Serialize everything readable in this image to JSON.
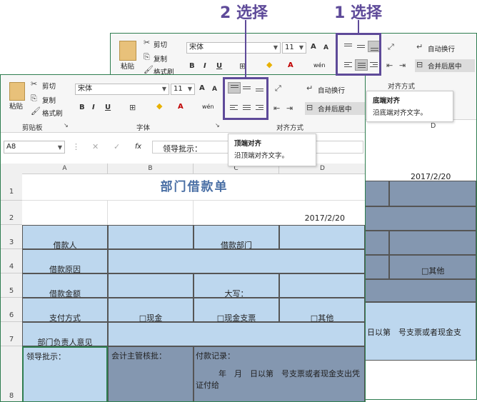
{
  "annotations": {
    "step1": "1 选择",
    "step2": "2 选择"
  },
  "clipboard": {
    "paste": "粘贴",
    "cut": "剪切",
    "copy": "复制",
    "format_painter": "格式刷",
    "group_label": "剪贴板"
  },
  "font": {
    "name": "宋体",
    "size": "11",
    "grow": "A",
    "shrink": "A",
    "bold": "B",
    "italic": "I",
    "underline": "U",
    "group_label": "字体",
    "font_color": "A",
    "phonetic": "wén"
  },
  "alignment": {
    "group_label": "对齐方式",
    "wrap_text": "自动换行",
    "merge_center": "合并后居中"
  },
  "tooltip_back": {
    "title": "底端对齐",
    "desc": "沿底端对齐文字。"
  },
  "tooltip_front": {
    "title": "顶端对齐",
    "desc": "沿顶端对齐文字。"
  },
  "formula_bar": {
    "cell_ref": "A8",
    "fx": "fx",
    "content": "领导批示："
  },
  "columns": [
    "A",
    "B",
    "C",
    "D"
  ],
  "rows": [
    "1",
    "2",
    "3",
    "4",
    "5",
    "6",
    "7",
    "8"
  ],
  "sheet": {
    "title": "部门借款单",
    "date": "2017/2/20",
    "borrower": "借款人",
    "dept": "借款部门",
    "reason": "借款原因",
    "amount": "借款金额",
    "capital": "大写：",
    "pay_method": "支付方式",
    "cash": "□现金",
    "check": "□现金支票",
    "other": "□其他",
    "dept_head": "部门负责人意见",
    "leader": "领导批示：",
    "accountant": "会计主管核批：",
    "pay_record": "付款记录：",
    "pay_detail": "年　月　日以第　号支票或者现金支出凭证付给"
  },
  "back_sheet": {
    "col_d": "D",
    "date": "2017/2/20",
    "other": "□其他",
    "detail": "日以第　号支票或者现金支",
    "cut": "剪切",
    "copy": "复制",
    "format_painter": "格式刷",
    "paste": "粘贴"
  }
}
